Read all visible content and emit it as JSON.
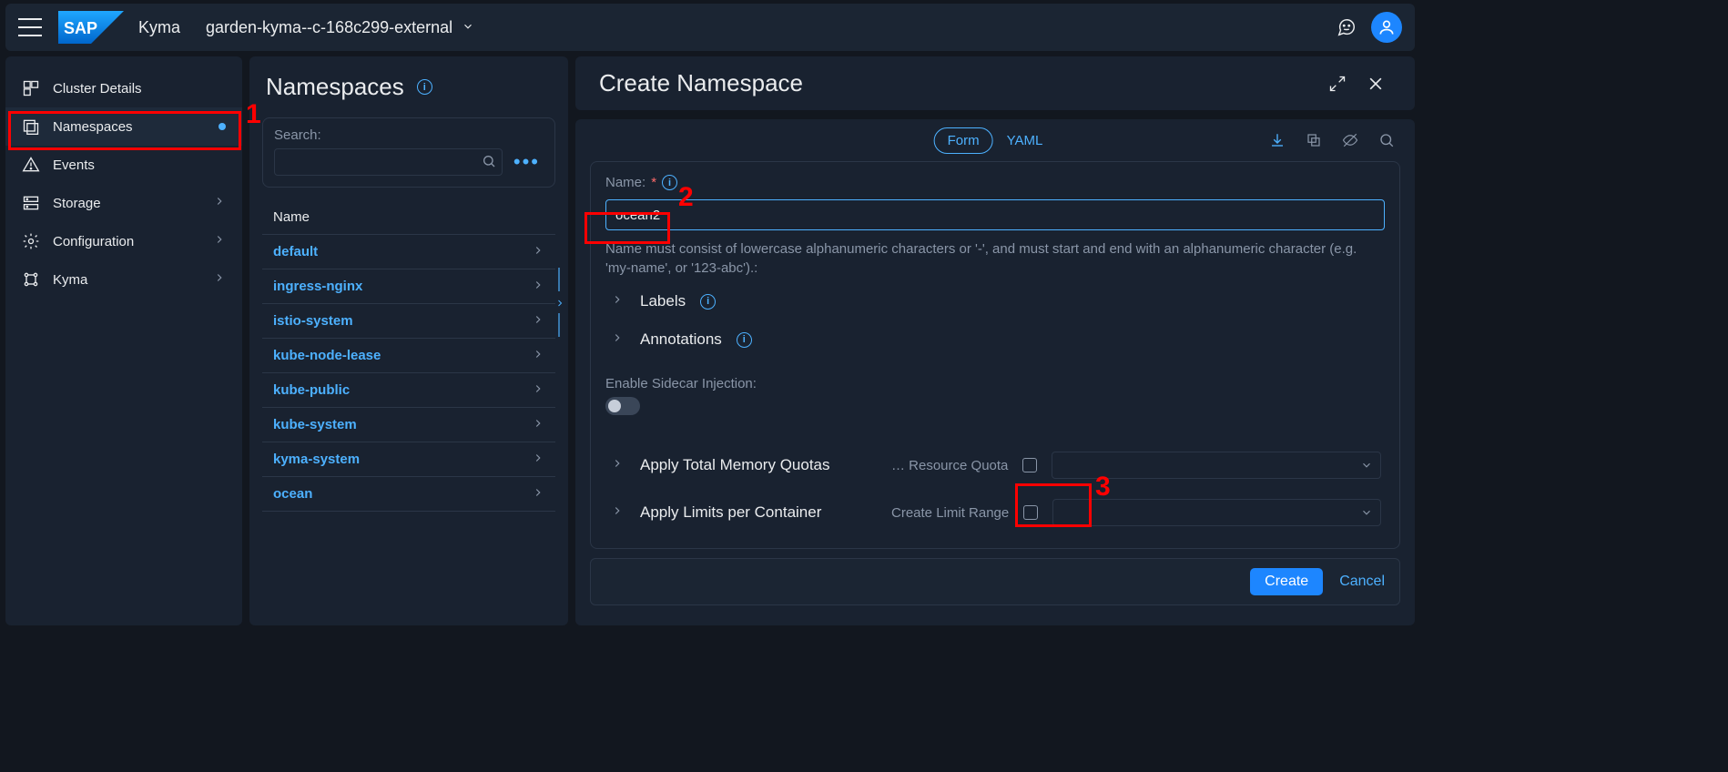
{
  "header": {
    "product": "Kyma",
    "cluster": "garden-kyma--c-168c299-external"
  },
  "sidebar": {
    "items": [
      {
        "key": "cluster-details",
        "label": "Cluster Details",
        "expandable": false,
        "active": false
      },
      {
        "key": "namespaces",
        "label": "Namespaces",
        "expandable": false,
        "active": true,
        "dot": true
      },
      {
        "key": "events",
        "label": "Events",
        "expandable": false,
        "active": false
      },
      {
        "key": "storage",
        "label": "Storage",
        "expandable": true,
        "active": false
      },
      {
        "key": "configuration",
        "label": "Configuration",
        "expandable": true,
        "active": false
      },
      {
        "key": "kyma",
        "label": "Kyma",
        "expandable": true,
        "active": false
      }
    ]
  },
  "list": {
    "title": "Namespaces",
    "search_label": "Search:",
    "column_header": "Name",
    "rows": [
      "default",
      "ingress-nginx",
      "istio-system",
      "kube-node-lease",
      "kube-public",
      "kube-system",
      "kyma-system",
      "ocean"
    ]
  },
  "create": {
    "title": "Create Namespace",
    "tabs": {
      "form": "Form",
      "yaml": "YAML"
    },
    "name_label": "Name:",
    "name_value": "ocean2",
    "name_help": "Name must consist of lowercase alphanumeric characters or '-', and must start and end with an alphanumeric character (e.g. 'my-name', or '123-abc').:",
    "labels_section": "Labels",
    "annotations_section": "Annotations",
    "sidecar_label": "Enable Sidecar Injection:",
    "apply_memory": "Apply Total Memory Quotas",
    "apply_limits": "Apply Limits per Container",
    "resource_quota": "… Resource Quota",
    "limit_range": "Create Limit Range",
    "create_btn": "Create",
    "cancel": "Cancel"
  },
  "annot": {
    "one": "1",
    "two": "2",
    "three": "3"
  }
}
